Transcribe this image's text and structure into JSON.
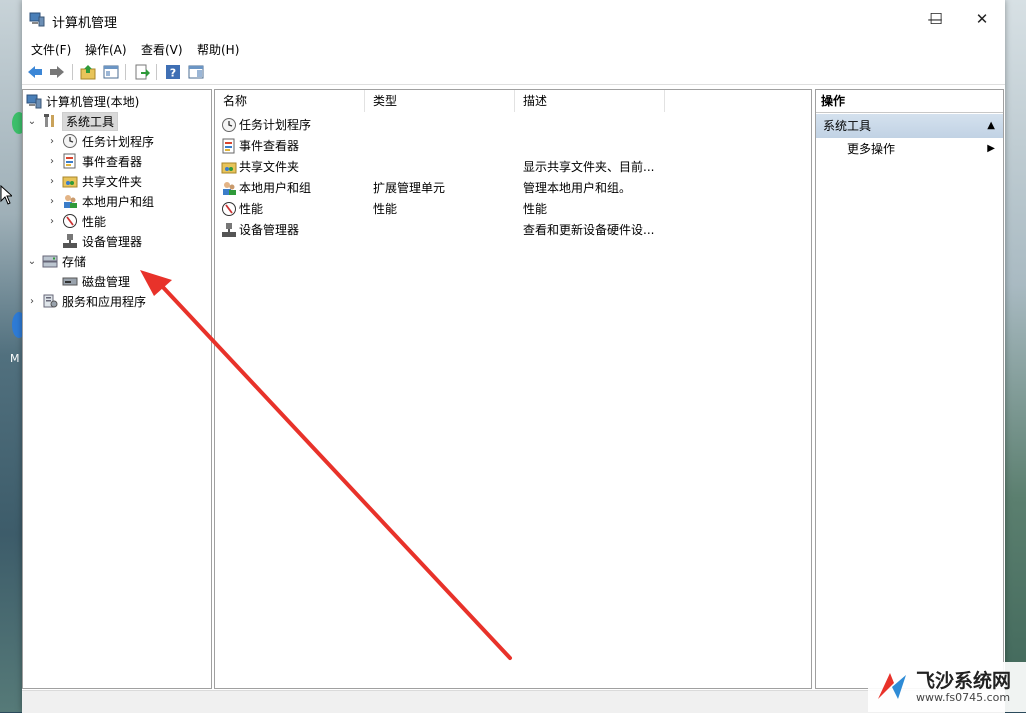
{
  "window": {
    "title": "计算机管理"
  },
  "title_buttons": {
    "minimize": "—",
    "maximize": "☐",
    "close": "✕"
  },
  "menu": [
    "文件(F)",
    "操作(A)",
    "查看(V)",
    "帮助(H)"
  ],
  "tree": {
    "root": "计算机管理(本地)",
    "system_tools": "系统工具",
    "task_scheduler": "任务计划程序",
    "event_viewer": "事件查看器",
    "shared_folders": "共享文件夹",
    "local_users": "本地用户和组",
    "performance": "性能",
    "device_manager": "设备管理器",
    "storage": "存储",
    "disk_management": "磁盘管理",
    "services": "服务和应用程序"
  },
  "list": {
    "columns": [
      "名称",
      "类型",
      "描述"
    ],
    "rows": [
      {
        "name": "任务计划程序",
        "type": "",
        "desc": ""
      },
      {
        "name": "事件查看器",
        "type": "",
        "desc": ""
      },
      {
        "name": "共享文件夹",
        "type": "",
        "desc": "显示共享文件夹、目前..."
      },
      {
        "name": "本地用户和组",
        "type": "扩展管理单元",
        "desc": "管理本地用户和组。"
      },
      {
        "name": "性能",
        "type": "性能",
        "desc": "性能"
      },
      {
        "name": "设备管理器",
        "type": "",
        "desc": "查看和更新设备硬件设..."
      }
    ]
  },
  "actions": {
    "header": "操作",
    "section": "系统工具",
    "more": "更多操作"
  },
  "colors": {
    "arrow": "#e8322a",
    "selection": "#d9d9d9",
    "action_section": "#c8d8ea"
  },
  "watermark": {
    "brand": "飞沙系统网",
    "url": "www.fs0745.com"
  },
  "desktop": {
    "edge_letter": "M"
  }
}
